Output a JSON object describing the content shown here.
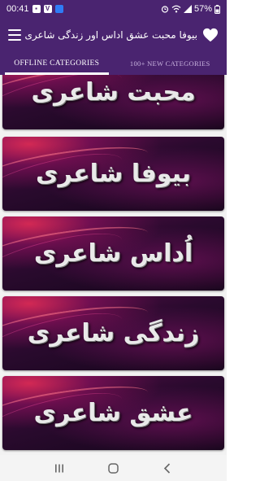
{
  "status_bar": {
    "time": "00:41",
    "battery": "57%",
    "icons": [
      "image-icon",
      "v-app-icon",
      "blue-app-icon",
      "alarm-icon",
      "wifi-icon",
      "signal-icon",
      "battery-icon"
    ]
  },
  "app_bar": {
    "title": "بیوفا محبت عشق اداس اور زندگی شاعری",
    "menu_icon": "hamburger-menu-icon",
    "favorite_icon": "heart-icon"
  },
  "tabs": [
    {
      "label": "OFFLINE CATEGORIES",
      "active": true
    },
    {
      "label": "100+ NEW CATEGORIES",
      "active": false
    }
  ],
  "categories": [
    {
      "label": "محبت شاعری"
    },
    {
      "label": "بیوفا شاعری"
    },
    {
      "label": "اُداس شاعری"
    },
    {
      "label": "زندگی شاعری"
    },
    {
      "label": "عشق شاعری"
    }
  ],
  "colors": {
    "primary": "#4a2470",
    "tab_indicator": "#ffffff",
    "card_dark": "#14061a",
    "card_accent": "#ff325a"
  },
  "nav_bar": {
    "icons": [
      "recent-apps-icon",
      "home-icon",
      "back-icon"
    ]
  }
}
